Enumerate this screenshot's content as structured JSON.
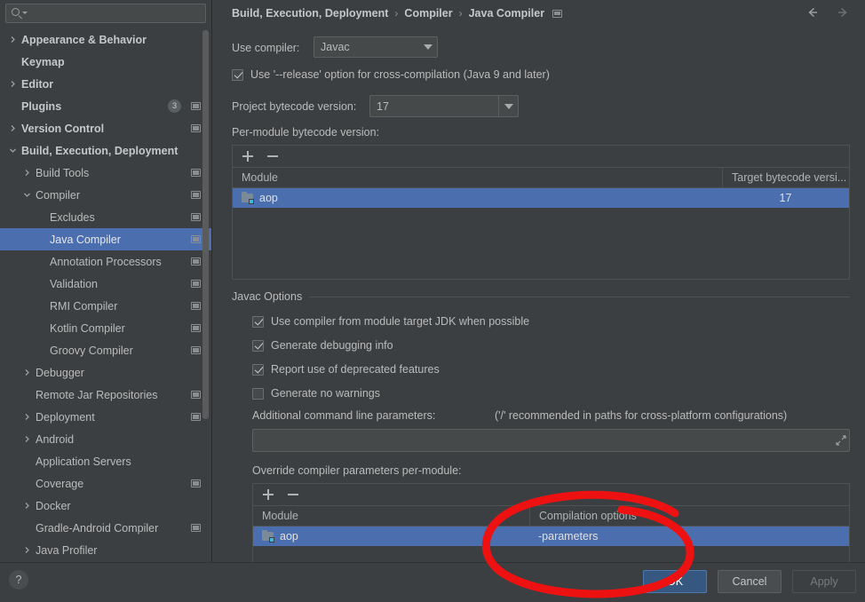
{
  "search": {
    "value": "",
    "placeholder": "",
    "icon": "search-icon"
  },
  "sidebar": {
    "items": [
      {
        "label": "Appearance & Behavior",
        "indent": 0,
        "arrow": "right",
        "bold": true,
        "badge": null,
        "project_icon": false,
        "selected": false
      },
      {
        "label": "Keymap",
        "indent": 0,
        "arrow": "none",
        "bold": true,
        "badge": null,
        "project_icon": false,
        "selected": false
      },
      {
        "label": "Editor",
        "indent": 0,
        "arrow": "right",
        "bold": true,
        "badge": null,
        "project_icon": false,
        "selected": false
      },
      {
        "label": "Plugins",
        "indent": 0,
        "arrow": "none",
        "bold": true,
        "badge": "3",
        "project_icon": true,
        "selected": false
      },
      {
        "label": "Version Control",
        "indent": 0,
        "arrow": "right",
        "bold": true,
        "badge": null,
        "project_icon": true,
        "selected": false
      },
      {
        "label": "Build, Execution, Deployment",
        "indent": 0,
        "arrow": "down",
        "bold": true,
        "badge": null,
        "project_icon": false,
        "selected": false
      },
      {
        "label": "Build Tools",
        "indent": 1,
        "arrow": "right",
        "bold": false,
        "badge": null,
        "project_icon": true,
        "selected": false
      },
      {
        "label": "Compiler",
        "indent": 1,
        "arrow": "down",
        "bold": false,
        "badge": null,
        "project_icon": true,
        "selected": false
      },
      {
        "label": "Excludes",
        "indent": 2,
        "arrow": "none",
        "bold": false,
        "badge": null,
        "project_icon": true,
        "selected": false
      },
      {
        "label": "Java Compiler",
        "indent": 2,
        "arrow": "none",
        "bold": false,
        "badge": null,
        "project_icon": true,
        "selected": true
      },
      {
        "label": "Annotation Processors",
        "indent": 2,
        "arrow": "none",
        "bold": false,
        "badge": null,
        "project_icon": true,
        "selected": false
      },
      {
        "label": "Validation",
        "indent": 2,
        "arrow": "none",
        "bold": false,
        "badge": null,
        "project_icon": true,
        "selected": false
      },
      {
        "label": "RMI Compiler",
        "indent": 2,
        "arrow": "none",
        "bold": false,
        "badge": null,
        "project_icon": true,
        "selected": false
      },
      {
        "label": "Kotlin Compiler",
        "indent": 2,
        "arrow": "none",
        "bold": false,
        "badge": null,
        "project_icon": true,
        "selected": false
      },
      {
        "label": "Groovy Compiler",
        "indent": 2,
        "arrow": "none",
        "bold": false,
        "badge": null,
        "project_icon": true,
        "selected": false
      },
      {
        "label": "Debugger",
        "indent": 1,
        "arrow": "right",
        "bold": false,
        "badge": null,
        "project_icon": false,
        "selected": false
      },
      {
        "label": "Remote Jar Repositories",
        "indent": 1,
        "arrow": "none",
        "bold": false,
        "badge": null,
        "project_icon": true,
        "selected": false
      },
      {
        "label": "Deployment",
        "indent": 1,
        "arrow": "right",
        "bold": false,
        "badge": null,
        "project_icon": true,
        "selected": false
      },
      {
        "label": "Android",
        "indent": 1,
        "arrow": "right",
        "bold": false,
        "badge": null,
        "project_icon": false,
        "selected": false
      },
      {
        "label": "Application Servers",
        "indent": 1,
        "arrow": "none",
        "bold": false,
        "badge": null,
        "project_icon": false,
        "selected": false
      },
      {
        "label": "Coverage",
        "indent": 1,
        "arrow": "none",
        "bold": false,
        "badge": null,
        "project_icon": true,
        "selected": false
      },
      {
        "label": "Docker",
        "indent": 1,
        "arrow": "right",
        "bold": false,
        "badge": null,
        "project_icon": false,
        "selected": false
      },
      {
        "label": "Gradle-Android Compiler",
        "indent": 1,
        "arrow": "none",
        "bold": false,
        "badge": null,
        "project_icon": true,
        "selected": false
      },
      {
        "label": "Java Profiler",
        "indent": 1,
        "arrow": "right",
        "bold": false,
        "badge": null,
        "project_icon": false,
        "selected": false
      }
    ]
  },
  "header": {
    "breadcrumb": [
      "Build, Execution, Deployment",
      "Compiler",
      "Java Compiler"
    ],
    "separator": "›",
    "back_icon": "arrow-left-icon",
    "forward_icon": "arrow-right-icon",
    "project_scope_icon": "project-settings-icon"
  },
  "main": {
    "use_compiler_label": "Use compiler:",
    "use_compiler_value": "Javac",
    "release_option_label": "Use '--release' option for cross-compilation (Java 9 and later)",
    "release_option_checked": true,
    "project_bytecode_label": "Project bytecode version:",
    "project_bytecode_value": "17",
    "per_module_label": "Per-module bytecode version:",
    "bytecode_table": {
      "columns": [
        "Module",
        "Target bytecode versi..."
      ],
      "rows": [
        {
          "module": "aop",
          "target": "17",
          "selected": true
        }
      ]
    },
    "javac_options_title": "Javac Options",
    "javac_checkboxes": [
      {
        "label": "Use compiler from module target JDK when possible",
        "checked": true
      },
      {
        "label": "Generate debugging info",
        "checked": true
      },
      {
        "label": "Report use of deprecated features",
        "checked": true
      },
      {
        "label": "Generate no warnings",
        "checked": false
      }
    ],
    "additional_params_label": "Additional command line parameters:",
    "additional_params_hint": "('/' recommended in paths for cross-platform configurations)",
    "additional_params_value": "",
    "override_label": "Override compiler parameters per-module:",
    "override_table": {
      "columns": [
        "Module",
        "Compilation options"
      ],
      "rows": [
        {
          "module": "aop",
          "options": "-parameters",
          "selected": true
        }
      ]
    },
    "toolbar": {
      "add_icon": "plus-icon",
      "remove_icon": "minus-icon"
    }
  },
  "footer": {
    "help_label": "?",
    "ok_label": "OK",
    "cancel_label": "Cancel",
    "apply_label": "Apply",
    "apply_enabled": false
  },
  "annotation": {
    "type": "hand-drawn-ellipse",
    "color": "#ee1111",
    "target": "Compilation options -parameters"
  },
  "colors": {
    "background": "#3c3f41",
    "selection": "#4b6eaf",
    "ok_button": "#365880",
    "annotation_red": "#ee1111"
  }
}
